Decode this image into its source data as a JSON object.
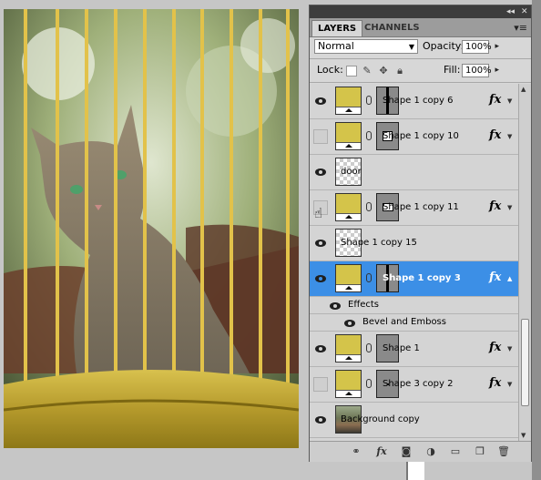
{
  "panel": {
    "tabs": [
      "LAYERS",
      "CHANNELS"
    ],
    "collapse_glyph": "◂◂",
    "close_glyph": "✕",
    "menu_glyph": "▾≡",
    "blend_mode": "Normal",
    "opacity_label": "Opacity:",
    "opacity_value": "100%",
    "lock_label": "Lock:",
    "fill_label": "Fill:",
    "fill_value": "100%"
  },
  "layers": [
    {
      "name": "Shape 1 copy 6",
      "visible": true,
      "thumb": "shape",
      "mask": "bar",
      "fx": true,
      "selected": false
    },
    {
      "name": "Shape 1 copy 10",
      "visible": false,
      "thumb": "shape",
      "mask": "square",
      "fx": true,
      "selected": false
    },
    {
      "name": "door",
      "visible": true,
      "thumb": "transparent",
      "mask": "none",
      "fx": false,
      "selected": false
    },
    {
      "name": "Shape 1 copy 11",
      "visible": false,
      "thumb": "shape",
      "mask": "smallsquare",
      "fx": true,
      "selected": false
    },
    {
      "name": "Shape 1 copy 15",
      "visible": true,
      "thumb": "transparent",
      "mask": "none",
      "fx": false,
      "selected": false
    },
    {
      "name": "Shape 1 copy 3",
      "visible": true,
      "thumb": "shape",
      "mask": "bar",
      "fx": true,
      "selected": true
    },
    {
      "name": "Shape 1",
      "visible": true,
      "thumb": "shape",
      "mask": "plain",
      "fx": true,
      "selected": false
    },
    {
      "name": "Shape 3 copy 2",
      "visible": false,
      "thumb": "shape",
      "mask": "dot",
      "fx": true,
      "selected": false
    },
    {
      "name": "Background copy",
      "visible": true,
      "thumb": "photo",
      "mask": "none",
      "fx": false,
      "selected": false
    }
  ],
  "effects": {
    "label": "Effects",
    "items": [
      "Bevel and Emboss"
    ]
  },
  "fx_label": "fx",
  "icons": {
    "lock": [
      "lock-transparent-icon",
      "lock-paint-icon",
      "lock-move-icon",
      "lock-all-icon"
    ],
    "bottom": [
      "link-layers-icon",
      "layer-style-icon",
      "add-mask-icon",
      "adjustment-layer-icon",
      "new-group-icon",
      "new-layer-icon",
      "delete-layer-icon"
    ]
  },
  "colors": {
    "selection": "#3c8fe6",
    "gold": "#d4c44a",
    "panel": "#d7d7d7"
  }
}
